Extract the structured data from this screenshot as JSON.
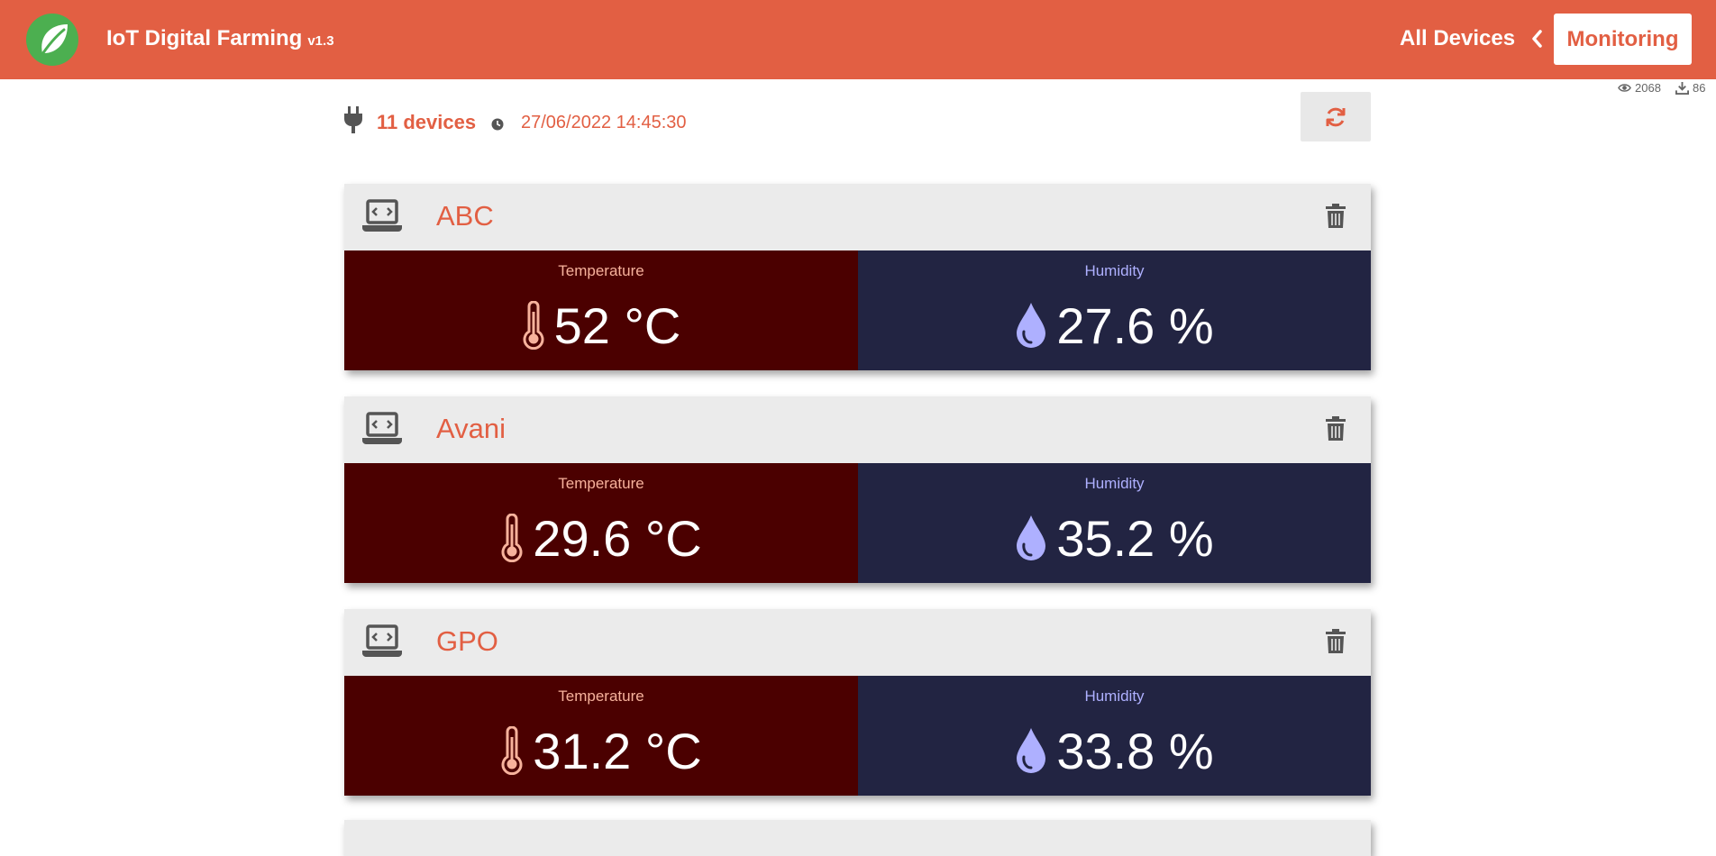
{
  "header": {
    "title": "IoT Digital Farming",
    "version": "v1.3",
    "nav_all_devices": "All Devices",
    "nav_monitoring": "Monitoring",
    "views": "2068",
    "downloads": "86"
  },
  "summary": {
    "device_count": "11 devices",
    "timestamp": "27/06/2022 14:45:30"
  },
  "devices": [
    {
      "name": "ABC",
      "temperature_label": "Temperature",
      "temperature": "52 °C",
      "humidity_label": "Humidity",
      "humidity": "27.6 %"
    },
    {
      "name": "Avani",
      "temperature_label": "Temperature",
      "temperature": "29.6 °C",
      "humidity_label": "Humidity",
      "humidity": "35.2 %"
    },
    {
      "name": "GPO",
      "temperature_label": "Temperature",
      "temperature": "31.2 °C",
      "humidity_label": "Humidity",
      "humidity": "33.8 %"
    }
  ],
  "colors": {
    "brand": "#e25f43",
    "card_header": "#ebebeb",
    "temperature_panel": "#4b0000",
    "humidity_panel": "#222442",
    "temperature_accent": "#f7b29c",
    "humidity_accent": "#aeb0ff"
  },
  "icons": {
    "logo": "leaf-icon",
    "plug": "plug-icon",
    "clock": "clock-icon",
    "refresh": "refresh-icon",
    "device": "laptop-code-icon",
    "delete": "trash-icon",
    "temperature": "thermometer-icon",
    "humidity": "water-drop-icon",
    "views": "eye-icon",
    "downloads": "download-icon"
  }
}
